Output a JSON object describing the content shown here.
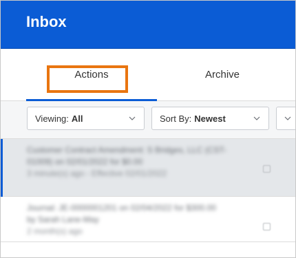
{
  "header": {
    "title": "Inbox"
  },
  "tabs": [
    {
      "label": "Actions",
      "selected": true
    },
    {
      "label": "Archive",
      "selected": false
    }
  ],
  "filters": {
    "viewing_label": "Viewing:",
    "viewing_value": "All",
    "sort_label": "Sort By:",
    "sort_value": "Newest"
  },
  "items": [
    {
      "lines": [
        "Customer Contract Amendment: S Bridges, LLC (CST-",
        "01009) on 02/01/2022 for $0.00",
        "3 minute(s) ago - Effective 02/01/2022"
      ]
    },
    {
      "lines": [
        "Journal: JE-0000001201 on 02/04/2022 for $300.00",
        "by Sarah Lane-May",
        "2 month(s) ago"
      ]
    }
  ],
  "colors": {
    "header_bg": "#0b5cd5",
    "tab_underline": "#0b5cd5",
    "highlight_box": "#e97510",
    "selected_row": "#e4e7ea"
  }
}
